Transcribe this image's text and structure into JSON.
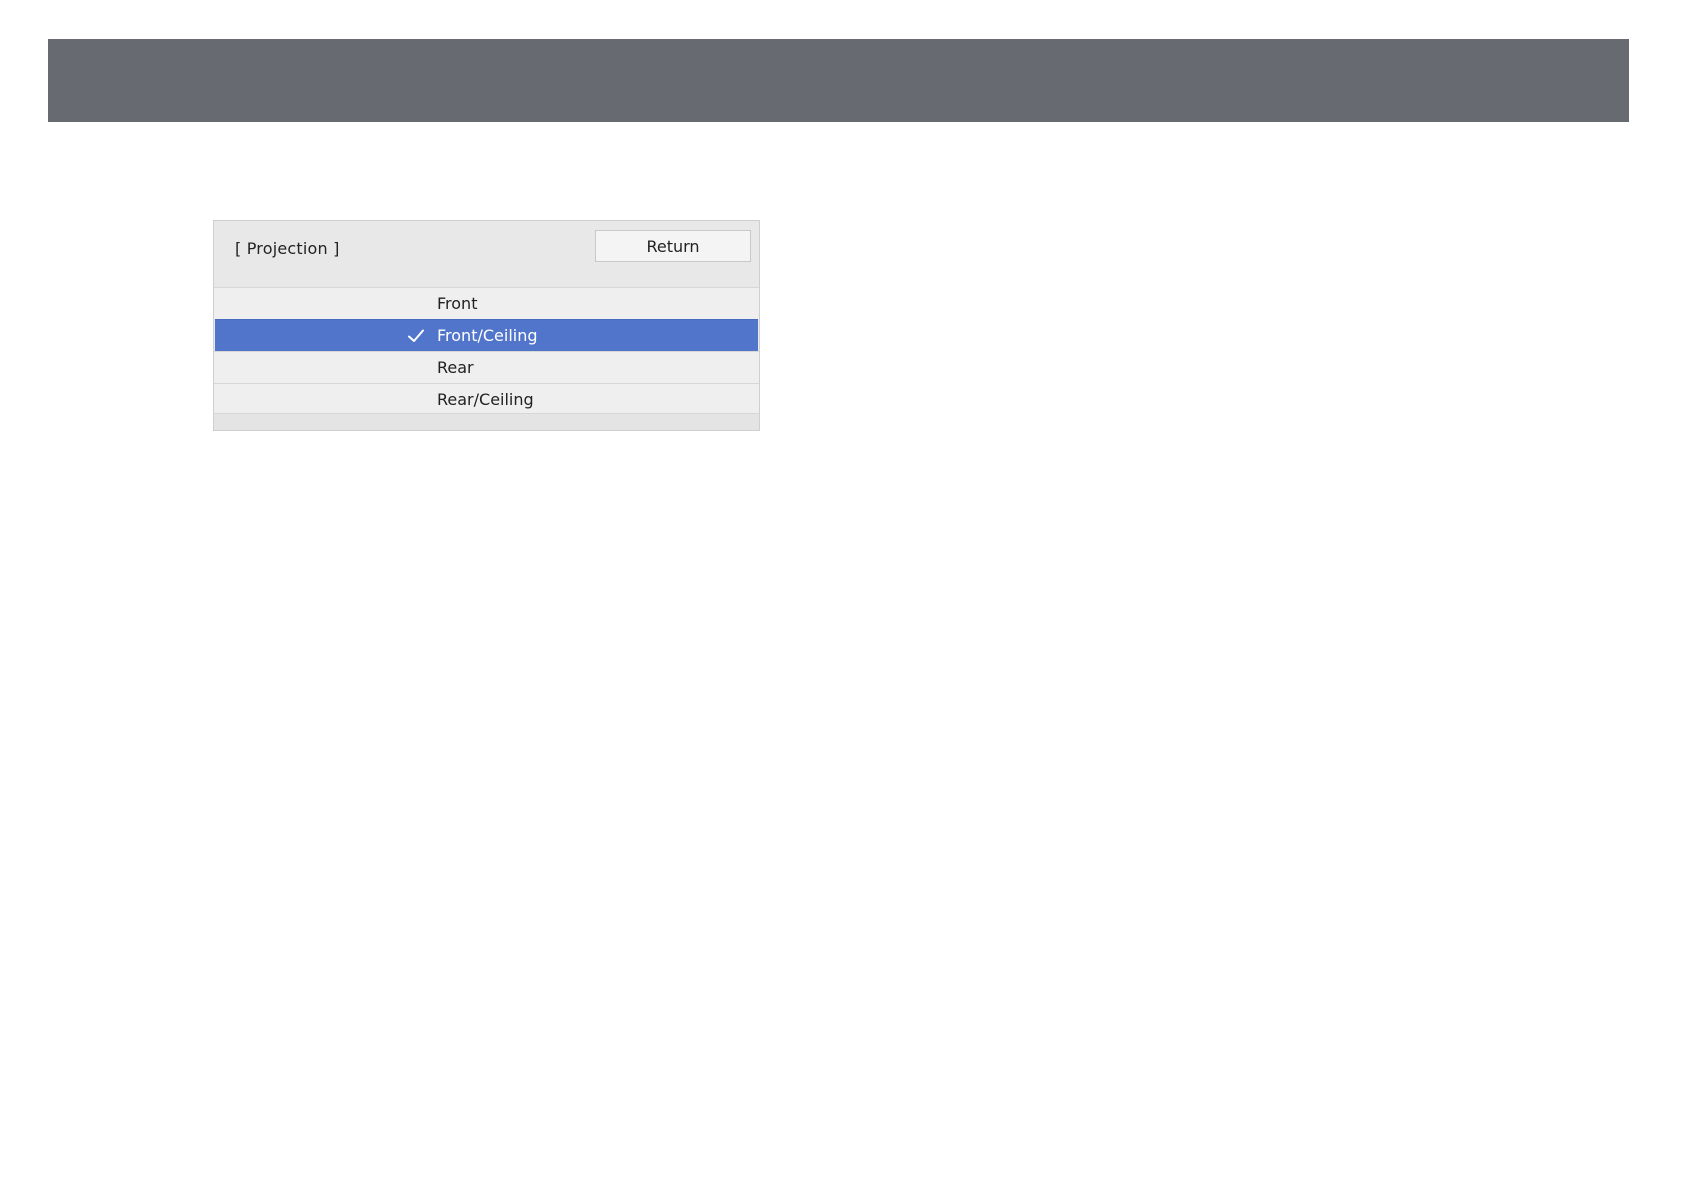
{
  "menu": {
    "title": "[ Projection ]",
    "return_label": "Return",
    "options": [
      {
        "label": "Front",
        "selected": false
      },
      {
        "label": "Front/Ceiling",
        "selected": true
      },
      {
        "label": "Rear",
        "selected": false
      },
      {
        "label": "Rear/Ceiling",
        "selected": false
      }
    ]
  },
  "icons": {
    "selected_marker": "checkmark-icon"
  },
  "colors": {
    "top_bar": "#686a72",
    "selected_row": "#5275cc",
    "panel_background": "#e8e8e8"
  }
}
